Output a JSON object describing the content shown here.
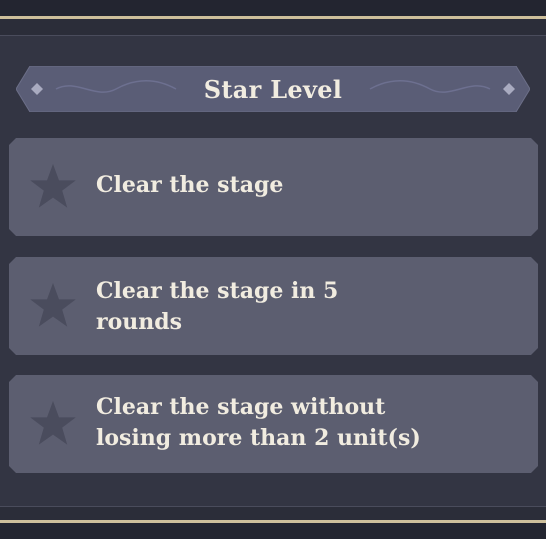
{
  "header": {
    "title": "Star Level"
  },
  "objectives": [
    {
      "text": "Clear the stage",
      "star_icon": "star-empty-icon"
    },
    {
      "text": "Clear the stage in 5 rounds",
      "star_icon": "star-empty-icon"
    },
    {
      "text": "Clear the stage without losing more than 2 unit(s)",
      "star_icon": "star-empty-icon"
    }
  ],
  "colors": {
    "background": "#333543",
    "card": "#5c5e70",
    "banner": "#5a5d76",
    "gold_trim": "#cdbf9b",
    "text": "#f1ece0",
    "star_empty": "#4a4c5d"
  }
}
